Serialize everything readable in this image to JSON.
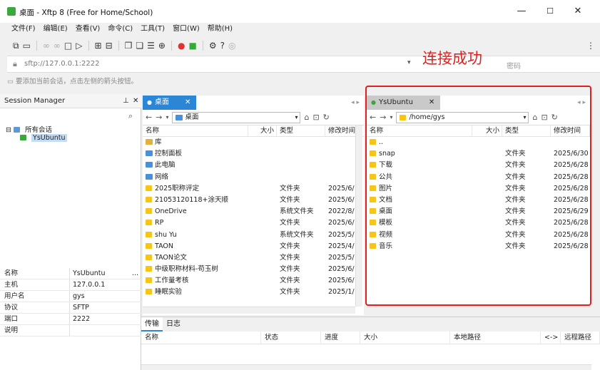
{
  "window": {
    "title": "桌面 - Xftp 8 (Free for Home/School)",
    "min": "—",
    "max": "☐",
    "close": "✕"
  },
  "menu": [
    "文件(F)",
    "编辑(E)",
    "查看(V)",
    "命令(C)",
    "工具(T)",
    "窗口(W)",
    "帮助(H)"
  ],
  "address": {
    "value": "sftp://127.0.0.1:2222",
    "password_placeholder": "密码"
  },
  "hint": "要添加当前会话，点击左侧的箭头按钮。",
  "annotation": "连接成功",
  "session_manager": {
    "title": "Session Manager",
    "tree_root": "所有会话",
    "tree_child": "YsUbuntu",
    "props": [
      {
        "k": "名称",
        "v": "YsUbuntu"
      },
      {
        "k": "主机",
        "v": "127.0.0.1"
      },
      {
        "k": "用户名",
        "v": "gys"
      },
      {
        "k": "协议",
        "v": "SFTP"
      },
      {
        "k": "端口",
        "v": "2222"
      },
      {
        "k": "说明",
        "v": ""
      }
    ]
  },
  "local": {
    "tab": "桌面",
    "path": "桌面",
    "cols": [
      "名称",
      "大小",
      "类型",
      "修改时间"
    ],
    "rows": [
      {
        "name": "库",
        "size": "",
        "type": "",
        "date": "",
        "icon": "library"
      },
      {
        "name": "控制面板",
        "size": "",
        "type": "",
        "date": "",
        "icon": "system"
      },
      {
        "name": "此电脑",
        "size": "",
        "type": "",
        "date": "",
        "icon": "system"
      },
      {
        "name": "网络",
        "size": "",
        "type": "",
        "date": "",
        "icon": "system"
      },
      {
        "name": "2025职称评定",
        "size": "",
        "type": "文件夹",
        "date": "2025/6/",
        "icon": "folder"
      },
      {
        "name": "21053120118+涂天顺",
        "size": "",
        "type": "文件夹",
        "date": "2025/6/",
        "icon": "folder"
      },
      {
        "name": "OneDrive",
        "size": "",
        "type": "系统文件夹",
        "date": "2022/8/",
        "icon": "folder"
      },
      {
        "name": "RP",
        "size": "",
        "type": "文件夹",
        "date": "2025/6/",
        "icon": "folder"
      },
      {
        "name": "shu Yu",
        "size": "",
        "type": "系统文件夹",
        "date": "2025/5/",
        "icon": "folder"
      },
      {
        "name": "TAON",
        "size": "",
        "type": "文件夹",
        "date": "2025/4/",
        "icon": "folder"
      },
      {
        "name": "TAON论文",
        "size": "",
        "type": "文件夹",
        "date": "2025/5/",
        "icon": "folder"
      },
      {
        "name": "中级职称材料-苟玉树",
        "size": "",
        "type": "文件夹",
        "date": "2025/6/",
        "icon": "folder"
      },
      {
        "name": "工作量考核",
        "size": "",
        "type": "文件夹",
        "date": "2025/6/",
        "icon": "folder"
      },
      {
        "name": "睡眠实验",
        "size": "",
        "type": "文件夹",
        "date": "2025/1/",
        "icon": "folder"
      }
    ]
  },
  "remote": {
    "tab": "YsUbuntu",
    "path": "/home/gys",
    "cols": [
      "名称",
      "大小",
      "类型",
      "修改时间"
    ],
    "rows": [
      {
        "name": "..",
        "type": "",
        "date": ""
      },
      {
        "name": "snap",
        "type": "文件夹",
        "date": "2025/6/30"
      },
      {
        "name": "下载",
        "type": "文件夹",
        "date": "2025/6/28"
      },
      {
        "name": "公共",
        "type": "文件夹",
        "date": "2025/6/28"
      },
      {
        "name": "图片",
        "type": "文件夹",
        "date": "2025/6/28"
      },
      {
        "name": "文档",
        "type": "文件夹",
        "date": "2025/6/28"
      },
      {
        "name": "桌面",
        "type": "文件夹",
        "date": "2025/6/29"
      },
      {
        "name": "模板",
        "type": "文件夹",
        "date": "2025/6/28"
      },
      {
        "name": "视频",
        "type": "文件夹",
        "date": "2025/6/28"
      },
      {
        "name": "音乐",
        "type": "文件夹",
        "date": "2025/6/28"
      }
    ]
  },
  "transfer": {
    "tabs": [
      "传输",
      "日志"
    ],
    "cols": [
      "名称",
      "状态",
      "进度",
      "大小",
      "本地路径",
      "<->",
      "远程路径"
    ]
  }
}
